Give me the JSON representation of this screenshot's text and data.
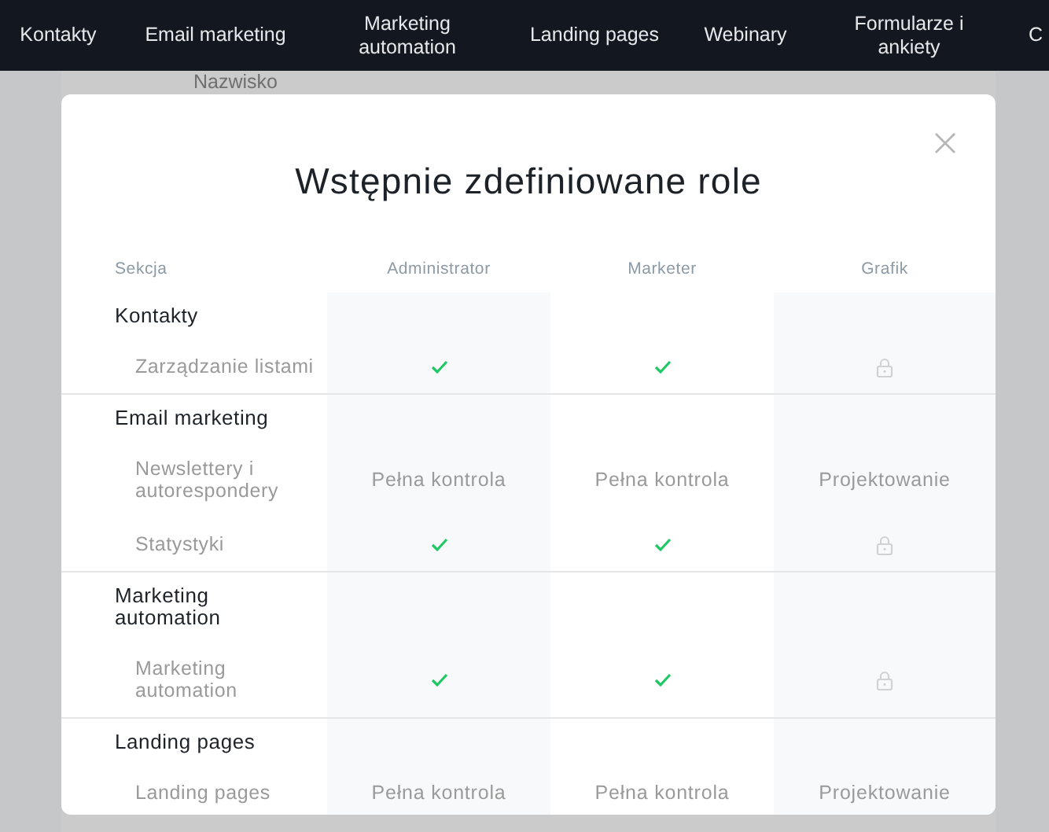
{
  "nav": [
    {
      "label": "Kontakty"
    },
    {
      "label": "Email marketing"
    },
    {
      "label": "Marketing automation"
    },
    {
      "label": "Landing pages"
    },
    {
      "label": "Webinary"
    },
    {
      "label": "Formularze i ankiety"
    },
    {
      "label": "C"
    }
  ],
  "background": {
    "column_label": "Nazwisko"
  },
  "modal": {
    "title": "Wstępnie zdefiniowane role",
    "columns": [
      "Sekcja",
      "Administrator",
      "Marketer",
      "Grafik"
    ],
    "groups": [
      {
        "name": "Kontakty",
        "items": [
          {
            "name": "Zarządzanie listami",
            "cells": [
              {
                "kind": "check"
              },
              {
                "kind": "check"
              },
              {
                "kind": "lock"
              }
            ]
          }
        ]
      },
      {
        "name": "Email marketing",
        "items": [
          {
            "name": "Newslettery i autorespondery",
            "cells": [
              {
                "kind": "text",
                "text": "Pełna kontrola"
              },
              {
                "kind": "text",
                "text": "Pełna kontrola"
              },
              {
                "kind": "text",
                "text": "Projektowanie"
              }
            ]
          },
          {
            "name": "Statystyki",
            "cells": [
              {
                "kind": "check"
              },
              {
                "kind": "check"
              },
              {
                "kind": "lock"
              }
            ]
          }
        ]
      },
      {
        "name": "Marketing automation",
        "items": [
          {
            "name": "Marketing automation",
            "cells": [
              {
                "kind": "check"
              },
              {
                "kind": "check"
              },
              {
                "kind": "lock"
              }
            ]
          }
        ]
      },
      {
        "name": "Landing pages",
        "items": [
          {
            "name": "Landing pages",
            "cells": [
              {
                "kind": "text",
                "text": "Pełna kontrola"
              },
              {
                "kind": "text",
                "text": "Pełna kontrola"
              },
              {
                "kind": "text",
                "text": "Projektowanie"
              }
            ]
          }
        ]
      }
    ]
  }
}
